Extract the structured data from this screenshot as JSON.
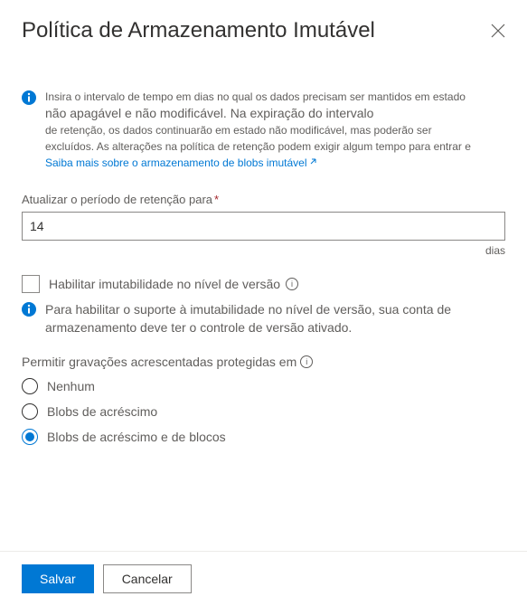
{
  "header": {
    "title": "Política de Armazenamento Imutável"
  },
  "info": {
    "line1": "Insira o intervalo de tempo em dias no qual os dados precisam ser mantidos em estado",
    "line2": "não apagável e não modificável. Na expiração do intervalo",
    "line3": "de retenção, os dados continuarão em estado não modificável, mas poderão ser",
    "line4": "excluídos. As alterações na política de retenção podem exigir algum tempo para entrar e",
    "linkText": "Saiba mais sobre o armazenamento de blobs imutável"
  },
  "retention": {
    "label": "Atualizar o período de retenção para",
    "value": "14",
    "unit": "dias"
  },
  "versionImmutability": {
    "checkboxLabel": "Habilitar imutabilidade no nível de versão",
    "helpText": "Para habilitar o suporte à imutabilidade no nível de versão, sua conta de armazenamento deve ter o controle de versão ativado."
  },
  "appendWrites": {
    "groupLabel": "Permitir gravações acrescentadas protegidas em",
    "options": [
      {
        "label": "Nenhum",
        "selected": false
      },
      {
        "label": "Blobs de acréscimo",
        "selected": false
      },
      {
        "label": "Blobs de acréscimo e de blocos",
        "selected": true
      }
    ]
  },
  "footer": {
    "save": "Salvar",
    "cancel": "Cancelar"
  }
}
